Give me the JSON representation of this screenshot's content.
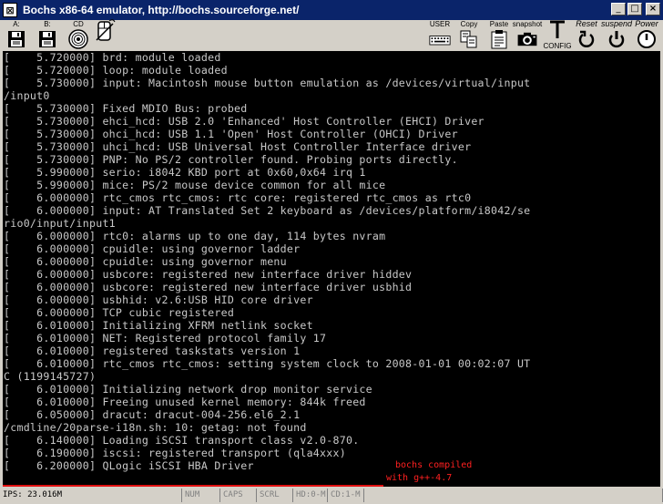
{
  "window": {
    "title": "Bochs x86-64 emulator, http://bochs.sourceforge.net/",
    "app_icon": "bochs-icon",
    "minimize_glyph": "_",
    "maximize_glyph": "□",
    "close_glyph": "×"
  },
  "toolbar": {
    "left": [
      {
        "label": "A:",
        "icon": "floppy-icon"
      },
      {
        "label": "B:",
        "icon": "floppy-icon"
      },
      {
        "label": "CD",
        "icon": "cdrom-icon"
      },
      {
        "label": "",
        "icon": "mouse-icon"
      }
    ],
    "right": [
      {
        "label": "USER",
        "icon": "keyboard-icon"
      },
      {
        "label": "Copy",
        "icon": "copy-icon"
      },
      {
        "label": "Paste",
        "icon": "paste-icon"
      },
      {
        "label": "snapshot",
        "icon": "camera-icon"
      },
      {
        "label": "CONFIG",
        "icon": "config-icon"
      },
      {
        "label": "Reset",
        "icon": "reset-icon"
      },
      {
        "label": "suspend",
        "icon": "suspend-icon"
      },
      {
        "label": "Power",
        "icon": "power-icon"
      }
    ]
  },
  "console": {
    "lines": [
      "[    5.720000] brd: module loaded",
      "[    5.720000] loop: module loaded",
      "[    5.730000] input: Macintosh mouse button emulation as /devices/virtual/input",
      "/input0",
      "[    5.730000] Fixed MDIO Bus: probed",
      "[    5.730000] ehci_hcd: USB 2.0 'Enhanced' Host Controller (EHCI) Driver",
      "[    5.730000] ohci_hcd: USB 1.1 'Open' Host Controller (OHCI) Driver",
      "[    5.730000] uhci_hcd: USB Universal Host Controller Interface driver",
      "[    5.730000] PNP: No PS/2 controller found. Probing ports directly.",
      "[    5.990000] serio: i8042 KBD port at 0x60,0x64 irq 1",
      "[    5.990000] mice: PS/2 mouse device common for all mice",
      "[    6.000000] rtc_cmos rtc_cmos: rtc core: registered rtc_cmos as rtc0",
      "[    6.000000] input: AT Translated Set 2 keyboard as /devices/platform/i8042/se",
      "rio0/input/input1",
      "[    6.000000] rtc0: alarms up to one day, 114 bytes nvram",
      "[    6.000000] cpuidle: using governor ladder",
      "[    6.000000] cpuidle: using governor menu",
      "[    6.000000] usbcore: registered new interface driver hiddev",
      "[    6.000000] usbcore: registered new interface driver usbhid",
      "[    6.000000] usbhid: v2.6:USB HID core driver",
      "[    6.000000] TCP cubic registered",
      "[    6.010000] Initializing XFRM netlink socket",
      "[    6.010000] NET: Registered protocol family 17",
      "[    6.010000] registered taskstats version 1",
      "[    6.010000] rtc_cmos rtc_cmos: setting system clock to 2008-01-01 00:02:07 UT",
      "C (1199145727)",
      "[    6.010000] Initializing network drop monitor service",
      "[    6.010000] Freeing unused kernel memory: 844k freed",
      "[    6.050000] dracut: dracut-004-256.el6_2.1",
      "/cmdline/20parse-i18n.sh: 10: getag: not found",
      "[    6.140000] Loading iSCSI transport class v2.0-870.",
      "[    6.190000] iscsi: registered transport (qla4xxx)",
      "[    6.200000] QLogic iSCSI HBA Driver"
    ],
    "annotation_line1": "bochs compiled",
    "annotation_line2": "with g++-4.7",
    "annotation_color": "#ff2020"
  },
  "statusbar": {
    "cells": [
      {
        "text": "IPS: 23.016M",
        "dim": false
      },
      {
        "text": "NUM",
        "dim": true
      },
      {
        "text": "CAPS",
        "dim": true
      },
      {
        "text": "SCRL",
        "dim": true
      },
      {
        "text": "HD:0-M",
        "dim": true
      },
      {
        "text": "CD:1-M",
        "dim": true
      },
      {
        "text": "",
        "dim": false
      }
    ]
  }
}
